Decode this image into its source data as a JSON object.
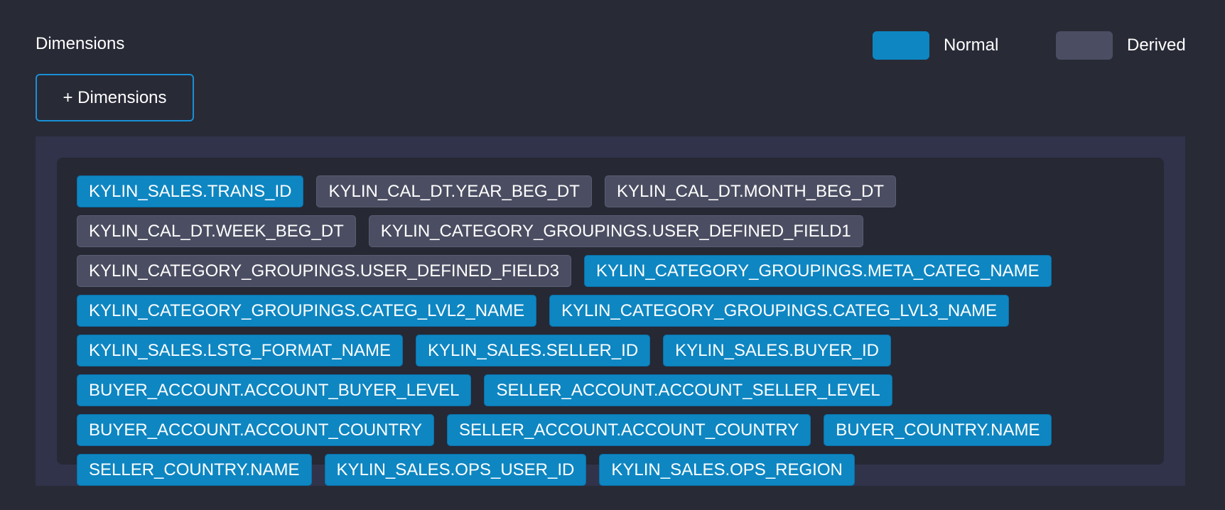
{
  "header": {
    "title": "Dimensions",
    "add_button_label": "+ Dimensions"
  },
  "legend": {
    "normal": {
      "label": "Normal",
      "color": "#0e86c2"
    },
    "derived": {
      "label": "Derived",
      "color": "#4b4e62"
    }
  },
  "dimensions": [
    {
      "label": "KYLIN_SALES.TRANS_ID",
      "type": "normal"
    },
    {
      "label": "KYLIN_CAL_DT.YEAR_BEG_DT",
      "type": "derived"
    },
    {
      "label": "KYLIN_CAL_DT.MONTH_BEG_DT",
      "type": "derived"
    },
    {
      "label": "KYLIN_CAL_DT.WEEK_BEG_DT",
      "type": "derived"
    },
    {
      "label": "KYLIN_CATEGORY_GROUPINGS.USER_DEFINED_FIELD1",
      "type": "derived"
    },
    {
      "label": "KYLIN_CATEGORY_GROUPINGS.USER_DEFINED_FIELD3",
      "type": "derived"
    },
    {
      "label": "KYLIN_CATEGORY_GROUPINGS.META_CATEG_NAME",
      "type": "normal"
    },
    {
      "label": "KYLIN_CATEGORY_GROUPINGS.CATEG_LVL2_NAME",
      "type": "normal"
    },
    {
      "label": "KYLIN_CATEGORY_GROUPINGS.CATEG_LVL3_NAME",
      "type": "normal"
    },
    {
      "label": "KYLIN_SALES.LSTG_FORMAT_NAME",
      "type": "normal"
    },
    {
      "label": "KYLIN_SALES.SELLER_ID",
      "type": "normal"
    },
    {
      "label": "KYLIN_SALES.BUYER_ID",
      "type": "normal"
    },
    {
      "label": "BUYER_ACCOUNT.ACCOUNT_BUYER_LEVEL",
      "type": "normal"
    },
    {
      "label": "SELLER_ACCOUNT.ACCOUNT_SELLER_LEVEL",
      "type": "normal"
    },
    {
      "label": "BUYER_ACCOUNT.ACCOUNT_COUNTRY",
      "type": "normal"
    },
    {
      "label": "SELLER_ACCOUNT.ACCOUNT_COUNTRY",
      "type": "normal"
    },
    {
      "label": "BUYER_COUNTRY.NAME",
      "type": "normal"
    },
    {
      "label": "SELLER_COUNTRY.NAME",
      "type": "normal"
    },
    {
      "label": "KYLIN_SALES.OPS_USER_ID",
      "type": "normal"
    },
    {
      "label": "KYLIN_SALES.OPS_REGION",
      "type": "normal"
    }
  ]
}
